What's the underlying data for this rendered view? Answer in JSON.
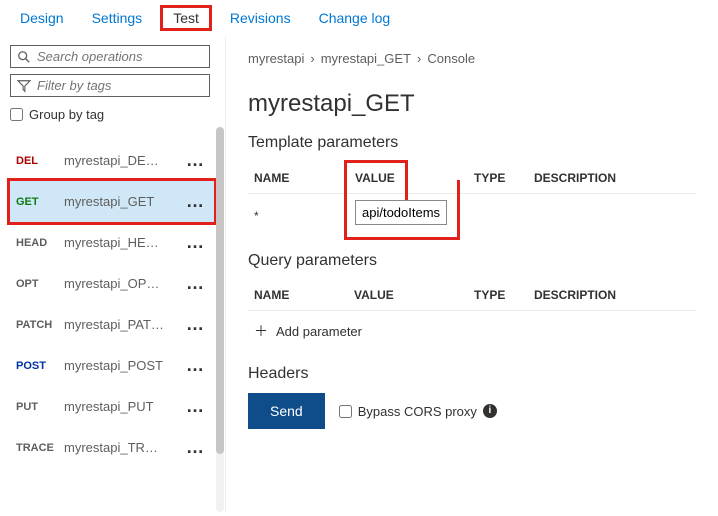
{
  "tabs": {
    "design": "Design",
    "settings": "Settings",
    "test": "Test",
    "revisions": "Revisions",
    "changelog": "Change log"
  },
  "sidebar": {
    "search_placeholder": "Search operations",
    "filter_placeholder": "Filter by tags",
    "group_by_label": "Group by tag",
    "operations": [
      {
        "verb": "DEL",
        "verb_class": "verb-del",
        "name": "myrestapi_DE…"
      },
      {
        "verb": "GET",
        "verb_class": "verb-get",
        "name": "myrestapi_GET",
        "selected": true
      },
      {
        "verb": "HEAD",
        "verb_class": "verb-head",
        "name": "myrestapi_HE…"
      },
      {
        "verb": "OPT",
        "verb_class": "verb-opt",
        "name": "myrestapi_OP…"
      },
      {
        "verb": "PATCH",
        "verb_class": "verb-patch",
        "name": "myrestapi_PAT…"
      },
      {
        "verb": "POST",
        "verb_class": "verb-post",
        "name": "myrestapi_POST"
      },
      {
        "verb": "PUT",
        "verb_class": "verb-put",
        "name": "myrestapi_PUT"
      },
      {
        "verb": "TRACE",
        "verb_class": "verb-trace",
        "name": "myrestapi_TR…"
      }
    ]
  },
  "breadcrumb": {
    "a": "myrestapi",
    "b": "myrestapi_GET",
    "c": "Console"
  },
  "page_title": "myrestapi_GET",
  "sections": {
    "template_params": "Template parameters",
    "query_params": "Query parameters",
    "headers": "Headers"
  },
  "table_headers": {
    "name": "NAME",
    "value": "VALUE",
    "type": "TYPE",
    "description": "DESCRIPTION"
  },
  "template_row": {
    "name": "*",
    "value": "api/todoItems"
  },
  "add_param_label": "Add parameter",
  "send_label": "Send",
  "bypass_label": "Bypass CORS proxy"
}
